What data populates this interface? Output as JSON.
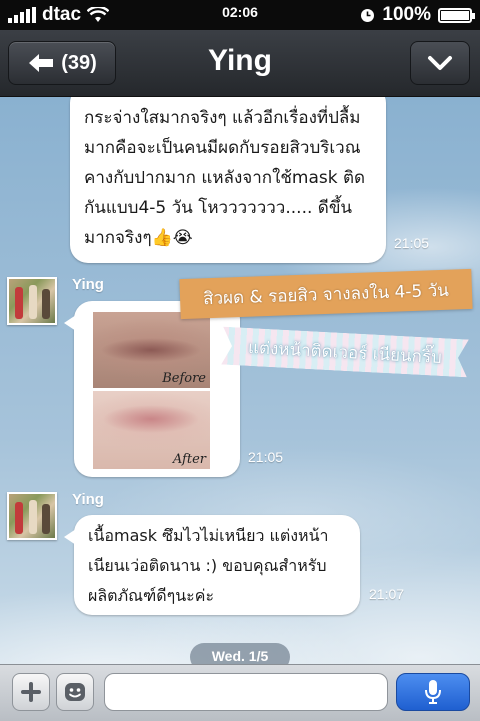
{
  "status_bar": {
    "carrier": "dtac",
    "time": "02:06",
    "battery": "100%",
    "icons": [
      "signal-icon",
      "wifi-icon",
      "clock-icon",
      "battery-charging-icon"
    ]
  },
  "nav": {
    "back_count": "(39)",
    "title": "Ying",
    "icons": [
      "back-arrow-icon",
      "chevron-down-icon"
    ]
  },
  "messages": [
    {
      "sender": "",
      "text": "กระจ่างใสมากจริงๆ แล้วอีกเรื่องที่ปลื้ม\nมากคือจะเป็นคนมีผดกับรอยสิวบริเวณ\nคางกับปากมาก แหลังจากใช้mask ติด\nกันแบบ4-5 วัน โหววววววว..... ดีขึ้น\nมากจริงๆ👍😭",
      "time": "21:05"
    },
    {
      "sender": "Ying",
      "type": "image",
      "labels": [
        "Before",
        "After"
      ],
      "time": "21:05"
    },
    {
      "sender": "Ying",
      "text": "เนื้อmask ซึมไวไม่เหนียว แต่งหน้า\nเนียนเว่อติดนาน :) ขอบคุณสำหรับ\nผลิตภัณฑ์ดีๆนะค่ะ",
      "time": "21:07"
    }
  ],
  "stickers": {
    "orange": "สิวผด & รอยสิว จางลงใน 4-5 วัน",
    "ribbon": "แต่งหน้าติดเวอร์ เนียนกริ๊บ"
  },
  "date_separator": "Wed. 1/5",
  "input": {
    "placeholder": "",
    "icons": [
      "plus-icon",
      "emoji-icon",
      "microphone-icon"
    ]
  },
  "colors": {
    "accent_blue": "#2a6fe0",
    "sticker_orange": "#e3a25a",
    "navbar": "#2e3136"
  }
}
